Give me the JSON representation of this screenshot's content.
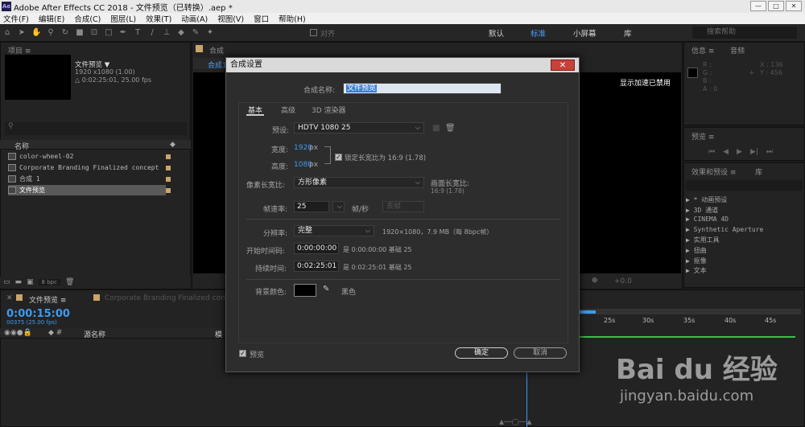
{
  "titlebar": {
    "logo": "Ae",
    "title": "Adobe After Effects CC 2018 - 文件预览（已转换）.aep *",
    "min": "—",
    "max": "□",
    "close": "✕"
  },
  "menu": [
    "文件(F)",
    "编辑(E)",
    "合成(C)",
    "图层(L)",
    "效果(T)",
    "动画(A)",
    "视图(V)",
    "窗口",
    "帮助(H)"
  ],
  "toolbar": {
    "snap_label": "对齐",
    "workspaces": [
      "默认",
      "标准",
      "小屏幕",
      "库"
    ],
    "active_workspace": "标准",
    "search_help": "搜索帮助"
  },
  "project": {
    "tab": "项目 ≡",
    "comp_name": "文件预览 ▼",
    "comp_size": "1920 x1080 (1.00)",
    "comp_duration": "△ 0:02:25:01, 25.00 fps",
    "col_name": "名称",
    "items": [
      "color-wheel-02",
      "Corporate Branding  Finalized concept",
      "合成 1",
      "文件预览"
    ],
    "bpc": "8 bpc"
  },
  "viewer": {
    "tab_prefix": "合成",
    "tab_name": "合成1",
    "gpu_notice": "显示加速已禁用",
    "zoom_value": "+0.0"
  },
  "info": {
    "tabs": [
      "信息 ≡",
      "音频"
    ],
    "r": "R :",
    "g": "G :",
    "b": "B :",
    "a": "A : 0",
    "x": "X : 136",
    "y": "Y : 456"
  },
  "preview": {
    "tab": "预览 ≡"
  },
  "effects": {
    "tabs": [
      "效果和预设 ≡",
      "库"
    ],
    "items": [
      "▶ * 动画预设",
      "▶ 3D 通道",
      "▶ CINEMA 4D",
      "▶ Synthetic Aperture",
      "▶ 实用工具",
      "▶ 扭曲",
      "▶ 抠像",
      "▶ 文本"
    ]
  },
  "timeline": {
    "tabs": [
      "文件预览 ≡",
      "Corporate Branding  Finalized concept"
    ],
    "timecode": "0:00:15:00",
    "frame": "00375 (25.00 fps)",
    "col_source": "源名称",
    "col_mode": "模",
    "ruler": [
      "25s",
      "30s",
      "35s",
      "40s",
      "45s"
    ]
  },
  "dialog": {
    "title": "合成设置",
    "close": "✕",
    "name_label": "合成名称:",
    "name_value": "文件预览",
    "tabs": [
      "基本",
      "高级",
      "3D 渲染器"
    ],
    "preset_label": "预设:",
    "preset_value": "HDTV 1080 25",
    "width_label": "宽度:",
    "width_value": "1920",
    "width_unit": "px",
    "height_label": "高度:",
    "height_value": "1080",
    "height_unit": "px",
    "lock_label": "锁定长宽比为 16:9 (1.78)",
    "par_label": "像素长宽比:",
    "par_value": "方形像素",
    "far_label": "画面长宽比:",
    "far_value": "16:9 (1.78)",
    "fps_label": "帧速率:",
    "fps_value": "25",
    "fps_unit": "帧/秒",
    "fps_drop": "丢帧",
    "res_label": "分辨率:",
    "res_value": "完整",
    "res_info": "1920×1080，7.9 MB（每 8bpc帧）",
    "start_label": "开始时间码:",
    "start_value": "0:00:00:00",
    "start_info": "是 0:00:00:00  基础 25",
    "dur_label": "持续时间:",
    "dur_value": "0:02:25:01",
    "dur_info": "是 0:02:25:01  基础 25",
    "bg_label": "背景颜色:",
    "bg_name": "黑色",
    "bg_color": "#000000",
    "preview_label": "预览",
    "ok": "确定",
    "cancel": "取消"
  },
  "watermark": {
    "brand": "Bai du 经验",
    "url": "jingyan.baidu.com"
  }
}
